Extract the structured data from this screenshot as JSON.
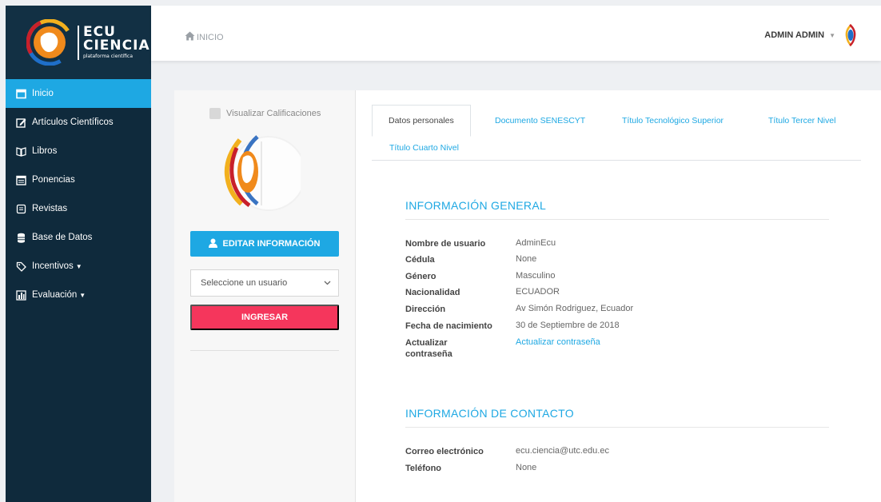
{
  "sidebar": {
    "logo": {
      "line1": "ECU",
      "line2": "CIENCIA",
      "line3": "plataforma científica"
    },
    "items": [
      {
        "label": "Inicio",
        "icon": "calendar-icon",
        "active": true
      },
      {
        "label": "Artículos Científicos",
        "icon": "edit-icon"
      },
      {
        "label": "Libros",
        "icon": "book-icon"
      },
      {
        "label": "Ponencias",
        "icon": "calendar-list-icon"
      },
      {
        "label": "Revistas",
        "icon": "newspaper-icon"
      },
      {
        "label": "Base de Datos",
        "icon": "database-icon"
      },
      {
        "label": "Incentivos",
        "icon": "tag-icon",
        "dropdown": true
      },
      {
        "label": "Evaluación",
        "icon": "chart-icon",
        "dropdown": true
      }
    ]
  },
  "topbar": {
    "breadcrumb": "INICIO",
    "user": "ADMIN ADMIN"
  },
  "profile": {
    "checkbox_label": "Visualizar Calificaciones",
    "edit_button": "EDITAR INFORMACIÓN",
    "select_placeholder": "Seleccione un usuario",
    "ingresar_button": "INGRESAR"
  },
  "tabs": [
    "Datos personales",
    "Documento SENESCYT",
    "Título Tecnológico Superior",
    "Título Tercer Nivel",
    "Título Cuarto Nivel"
  ],
  "general": {
    "title": "INFORMACIÓN GENERAL",
    "rows": [
      {
        "label": "Nombre de usuario",
        "value": "AdminEcu"
      },
      {
        "label": "Cédula",
        "value": "None"
      },
      {
        "label": "Género",
        "value": "Masculino"
      },
      {
        "label": "Nacionalidad",
        "value": "ECUADOR"
      },
      {
        "label": "Dirección",
        "value": "Av Simón Rodriguez, Ecuador"
      },
      {
        "label": "Fecha de nacimiento",
        "value": "30 de Septiembre de 2018"
      },
      {
        "label": "Actualizar contraseña",
        "value": "Actualizar contraseña"
      }
    ]
  },
  "contact": {
    "title": "INFORMACIÓN DE CONTACTO",
    "rows": [
      {
        "label": "Correo electrónico",
        "value": "ecu.ciencia@utc.edu.ec"
      },
      {
        "label": "Teléfono",
        "value": "None"
      }
    ]
  },
  "colors": {
    "accent": "#1ea8e3",
    "danger": "#f5365c",
    "sidebar": "#0f2a3c"
  }
}
